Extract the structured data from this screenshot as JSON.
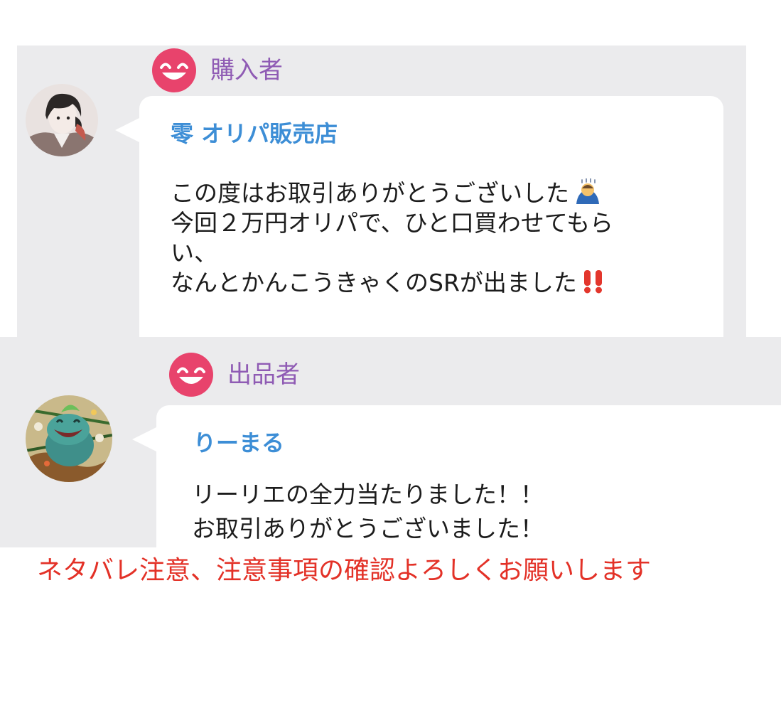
{
  "panels": [
    {
      "role": "購入者",
      "sender": "零 オリパ販売店",
      "lines": [
        "この度はお取引ありがとうございした",
        "今回２万円オリパで、ひと口買わせてもら",
        "い、",
        "なんとかんこうきゃくのSRが出ました"
      ],
      "emoji_after_line1": "bowing-person-emoji",
      "emoji_after_line4": "double-exclamation-emoji"
    },
    {
      "role": "出品者",
      "sender": "りーまる",
      "lines": [
        "リーリエの全力当たりました！！",
        "お取引ありがとうございました！"
      ]
    }
  ],
  "notice": "ネタバレ注意、注意事項の確認よろしくお願いします",
  "colors": {
    "panel_bg": "#ebebed",
    "role_text": "#8f5bb4",
    "role_icon": "#e8436c",
    "sender_name": "#3d8ed6",
    "notice_text": "#e33127"
  },
  "icons": [
    "grinning-face-icon",
    "user-avatar",
    "seller-avatar"
  ]
}
